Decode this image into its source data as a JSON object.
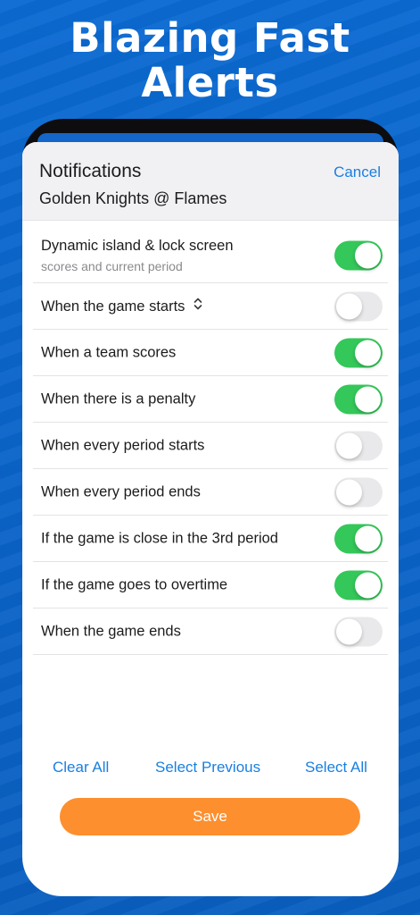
{
  "headline": {
    "line1": "Blazing Fast",
    "line2": "Alerts"
  },
  "sheet": {
    "title": "Notifications",
    "subtitle": "Golden Knights @ Flames",
    "cancel_label": "Cancel"
  },
  "rows": [
    {
      "label": "Dynamic island & lock screen",
      "sublabel": "scores and current period",
      "on": true
    },
    {
      "label": "When the game starts",
      "chevron": "⌃⌄",
      "on": false
    },
    {
      "label": "When a team scores",
      "on": true
    },
    {
      "label": "When there is a penalty",
      "on": true
    },
    {
      "label": "When every period starts",
      "on": false
    },
    {
      "label": "When every period ends",
      "on": false
    },
    {
      "label": "If the game is close in the 3rd period",
      "on": true
    },
    {
      "label": "If the game goes to overtime",
      "on": true
    },
    {
      "label": "When the game ends",
      "on": false
    }
  ],
  "actions": {
    "clear_all": "Clear All",
    "select_previous": "Select Previous",
    "select_all": "Select All",
    "save": "Save"
  },
  "colors": {
    "background": "#0a64c8",
    "accent": "#1a7fe0",
    "toggle_on": "#34c759",
    "save": "#fd8f2e"
  }
}
